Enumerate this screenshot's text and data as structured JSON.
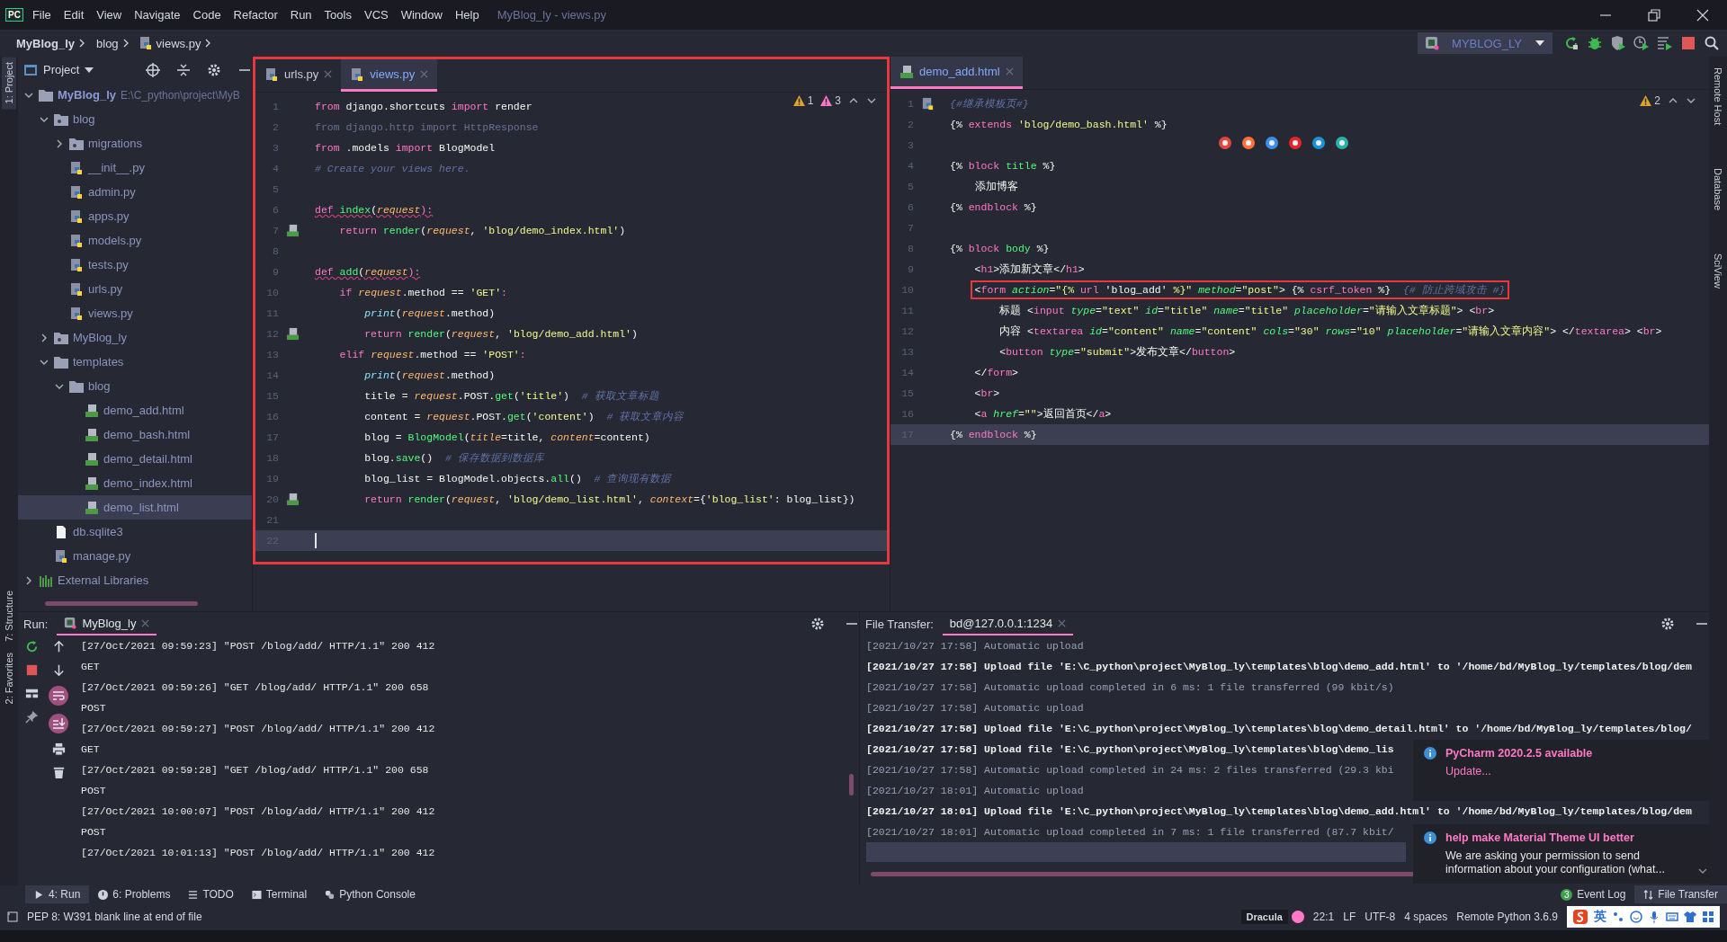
{
  "window": {
    "logo": "PC",
    "menu": [
      "File",
      "Edit",
      "View",
      "Navigate",
      "Code",
      "Refactor",
      "Run",
      "Tools",
      "VCS",
      "Window",
      "Help"
    ],
    "title": "MyBlog_ly - views.py"
  },
  "breadcrumbs": [
    {
      "label": "MyBlog_ly",
      "kind": "project"
    },
    {
      "label": "blog",
      "kind": "folder"
    },
    {
      "label": "views.py",
      "kind": "python"
    }
  ],
  "run_config": {
    "name": "MYBLOG_LY"
  },
  "left_strip": {
    "top": [
      {
        "label": "1: Project",
        "selected": true
      }
    ],
    "bottom": [
      {
        "label": "7: Structure",
        "selected": false
      },
      {
        "label": "2: Favorites",
        "selected": false
      }
    ]
  },
  "right_strip": [
    {
      "label": "Remote Host",
      "selected": false
    },
    {
      "label": "Database",
      "selected": false
    },
    {
      "label": "SciView",
      "selected": false
    }
  ],
  "project_panel": {
    "title": "Project",
    "tree": [
      {
        "name": "MyBlog_ly",
        "path": "E:\\C_python\\project\\MyB",
        "kind": "folder",
        "expanded": true,
        "selected": false,
        "children": [
          {
            "name": "blog",
            "kind": "package",
            "expanded": true,
            "selected": false,
            "children": [
              {
                "name": "migrations",
                "kind": "package",
                "expanded": false,
                "selected": false
              },
              {
                "name": "__init__.py",
                "kind": "python",
                "selected": false
              },
              {
                "name": "admin.py",
                "kind": "python",
                "selected": false
              },
              {
                "name": "apps.py",
                "kind": "python",
                "selected": false
              },
              {
                "name": "models.py",
                "kind": "python",
                "selected": false
              },
              {
                "name": "tests.py",
                "kind": "python",
                "selected": false
              },
              {
                "name": "urls.py",
                "kind": "python",
                "selected": false
              },
              {
                "name": "views.py",
                "kind": "python",
                "selected": false
              }
            ]
          },
          {
            "name": "MyBlog_ly",
            "kind": "package",
            "expanded": false,
            "selected": false
          },
          {
            "name": "templates",
            "kind": "folder",
            "expanded": true,
            "selected": false,
            "children": [
              {
                "name": "blog",
                "kind": "folder",
                "expanded": true,
                "selected": false,
                "children": [
                  {
                    "name": "demo_add.html",
                    "kind": "html",
                    "selected": false
                  },
                  {
                    "name": "demo_bash.html",
                    "kind": "html",
                    "selected": false
                  },
                  {
                    "name": "demo_detail.html",
                    "kind": "html",
                    "selected": false
                  },
                  {
                    "name": "demo_index.html",
                    "kind": "html",
                    "selected": false
                  },
                  {
                    "name": "demo_list.html",
                    "kind": "html",
                    "selected": true
                  }
                ]
              }
            ]
          },
          {
            "name": "db.sqlite3",
            "kind": "file",
            "selected": false
          },
          {
            "name": "manage.py",
            "kind": "python",
            "selected": false
          }
        ]
      },
      {
        "name": "External Libraries",
        "kind": "library",
        "expanded": false,
        "selected": false
      }
    ]
  },
  "editors": [
    {
      "annotated": true,
      "tabs": [
        {
          "label": "urls.py",
          "kind": "python",
          "selected": false
        },
        {
          "label": "views.py",
          "kind": "python",
          "selected": true
        }
      ],
      "inspections": [
        {
          "kind": "warning",
          "count": "1"
        },
        {
          "kind": "weak",
          "count": "3"
        }
      ],
      "lines": [
        {
          "no": "1",
          "tokens": [
            {
              "text": "from",
              "kind": "kw"
            },
            {
              "text": " django.shortcuts ",
              "kind": "txt"
            },
            {
              "text": "import",
              "kind": "kw"
            },
            {
              "text": " render",
              "kind": "txt"
            }
          ]
        },
        {
          "no": "2",
          "tokens": [
            {
              "text": "from django.http import HttpResponse",
              "kind": "dim"
            }
          ]
        },
        {
          "no": "3",
          "tokens": [
            {
              "text": "from",
              "kind": "kw"
            },
            {
              "text": " .models ",
              "kind": "txt"
            },
            {
              "text": "import",
              "kind": "kw"
            },
            {
              "text": " BlogModel",
              "kind": "txt"
            }
          ]
        },
        {
          "no": "4",
          "tokens": [
            {
              "text": "# Create your views here.",
              "kind": "com"
            }
          ]
        },
        {
          "no": "5"
        },
        {
          "no": "6",
          "squiggle": true,
          "tokens": [
            {
              "text": "def ",
              "kind": "kw"
            },
            {
              "text": "index",
              "kind": "fn"
            },
            {
              "text": "(",
              "kind": "txt"
            },
            {
              "text": "request",
              "kind": "par"
            },
            {
              "text": "):",
              "kind": "kw"
            }
          ]
        },
        {
          "no": "7",
          "gutter": {
            "kind": "html"
          },
          "tokens": [
            {
              "text": "    return ",
              "kind": "kw"
            },
            {
              "text": "render",
              "kind": "fn"
            },
            {
              "text": "(",
              "kind": "txt"
            },
            {
              "text": "request",
              "kind": "par"
            },
            {
              "text": ", ",
              "kind": "txt"
            },
            {
              "text": "'blog/demo_index.html'",
              "kind": "str"
            },
            {
              "text": ")",
              "kind": "txt"
            }
          ]
        },
        {
          "no": "8"
        },
        {
          "no": "9",
          "squiggle": true,
          "tokens": [
            {
              "text": "def ",
              "kind": "kw"
            },
            {
              "text": "add",
              "kind": "fn"
            },
            {
              "text": "(",
              "kind": "txt"
            },
            {
              "text": "request",
              "kind": "par"
            },
            {
              "text": "):",
              "kind": "kw"
            }
          ]
        },
        {
          "no": "10",
          "tokens": [
            {
              "text": "    if ",
              "kind": "kw"
            },
            {
              "text": "request",
              "kind": "par"
            },
            {
              "text": ".method == ",
              "kind": "txt"
            },
            {
              "text": "'GET'",
              "kind": "str"
            },
            {
              "text": ":",
              "kind": "kw"
            }
          ]
        },
        {
          "no": "11",
          "tokens": [
            {
              "text": "        print",
              "kind": "bi"
            },
            {
              "text": "(",
              "kind": "txt"
            },
            {
              "text": "request",
              "kind": "par"
            },
            {
              "text": ".method)",
              "kind": "txt"
            }
          ]
        },
        {
          "no": "12",
          "gutter": {
            "kind": "html"
          },
          "tokens": [
            {
              "text": "        return ",
              "kind": "kw"
            },
            {
              "text": "render",
              "kind": "fn"
            },
            {
              "text": "(",
              "kind": "txt"
            },
            {
              "text": "request",
              "kind": "par"
            },
            {
              "text": ", ",
              "kind": "txt"
            },
            {
              "text": "'blog/demo_add.html'",
              "kind": "str"
            },
            {
              "text": ")",
              "kind": "txt"
            }
          ]
        },
        {
          "no": "13",
          "tokens": [
            {
              "text": "    elif ",
              "kind": "kw"
            },
            {
              "text": "request",
              "kind": "par"
            },
            {
              "text": ".method == ",
              "kind": "txt"
            },
            {
              "text": "'POST'",
              "kind": "str"
            },
            {
              "text": ":",
              "kind": "kw"
            }
          ]
        },
        {
          "no": "14",
          "tokens": [
            {
              "text": "        print",
              "kind": "bi"
            },
            {
              "text": "(",
              "kind": "txt"
            },
            {
              "text": "request",
              "kind": "par"
            },
            {
              "text": ".method)",
              "kind": "txt"
            }
          ]
        },
        {
          "no": "15",
          "tokens": [
            {
              "text": "        title = ",
              "kind": "txt"
            },
            {
              "text": "request",
              "kind": "par"
            },
            {
              "text": ".POST.",
              "kind": "txt"
            },
            {
              "text": "get",
              "kind": "fn"
            },
            {
              "text": "(",
              "kind": "txt"
            },
            {
              "text": "'title'",
              "kind": "str"
            },
            {
              "text": ")  ",
              "kind": "txt"
            },
            {
              "text": "# 获取文章标题",
              "kind": "com"
            }
          ]
        },
        {
          "no": "16",
          "tokens": [
            {
              "text": "        content = ",
              "kind": "txt"
            },
            {
              "text": "request",
              "kind": "par"
            },
            {
              "text": ".POST.",
              "kind": "txt"
            },
            {
              "text": "get",
              "kind": "fn"
            },
            {
              "text": "(",
              "kind": "txt"
            },
            {
              "text": "'content'",
              "kind": "str"
            },
            {
              "text": ")  ",
              "kind": "txt"
            },
            {
              "text": "# 获取文章内容",
              "kind": "com"
            }
          ]
        },
        {
          "no": "17",
          "tokens": [
            {
              "text": "        blog = ",
              "kind": "txt"
            },
            {
              "text": "BlogModel",
              "kind": "fn"
            },
            {
              "text": "(",
              "kind": "txt"
            },
            {
              "text": "title",
              "kind": "par"
            },
            {
              "text": "=title, ",
              "kind": "txt"
            },
            {
              "text": "content",
              "kind": "par"
            },
            {
              "text": "=content)",
              "kind": "txt"
            }
          ]
        },
        {
          "no": "18",
          "tokens": [
            {
              "text": "        blog.",
              "kind": "txt"
            },
            {
              "text": "save",
              "kind": "fn"
            },
            {
              "text": "()  ",
              "kind": "txt"
            },
            {
              "text": "# 保存数据到数据库",
              "kind": "com"
            }
          ]
        },
        {
          "no": "19",
          "tokens": [
            {
              "text": "        blog_list = BlogModel.objects.",
              "kind": "txt"
            },
            {
              "text": "all",
              "kind": "fn"
            },
            {
              "text": "()  ",
              "kind": "txt"
            },
            {
              "text": "# 查询现有数据",
              "kind": "com"
            }
          ]
        },
        {
          "no": "20",
          "gutter": {
            "kind": "html"
          },
          "tokens": [
            {
              "text": "        return ",
              "kind": "kw"
            },
            {
              "text": "render",
              "kind": "fn"
            },
            {
              "text": "(",
              "kind": "txt"
            },
            {
              "text": "request",
              "kind": "par"
            },
            {
              "text": ", ",
              "kind": "txt"
            },
            {
              "text": "'blog/demo_list.html'",
              "kind": "str"
            },
            {
              "text": ", ",
              "kind": "txt"
            },
            {
              "text": "context",
              "kind": "par"
            },
            {
              "text": "={",
              "kind": "txt"
            },
            {
              "text": "'blog_list'",
              "kind": "str"
            },
            {
              "text": ": blog_list})",
              "kind": "txt"
            }
          ]
        },
        {
          "no": "21"
        },
        {
          "no": "22",
          "current": true,
          "caret": true
        }
      ]
    },
    {
      "tabs": [
        {
          "label": "demo_add.html",
          "kind": "html",
          "selected": true
        }
      ],
      "inspections": [
        {
          "kind": "warning",
          "count": "2"
        }
      ],
      "lines": [
        {
          "no": "1",
          "gutter": {
            "kind": "python"
          },
          "tokens": [
            {
              "text": "{#继承模板页#}",
              "kind": "com"
            }
          ]
        },
        {
          "no": "2",
          "tokens": [
            {
              "text": "{% ",
              "kind": "txt"
            },
            {
              "text": "extends ",
              "kind": "kw"
            },
            {
              "text": "'blog/demo_bash.html'",
              "kind": "str"
            },
            {
              "text": " %}",
              "kind": "txt"
            }
          ]
        },
        {
          "no": "3"
        },
        {
          "no": "4",
          "tokens": [
            {
              "text": "{% ",
              "kind": "txt"
            },
            {
              "text": "block ",
              "kind": "kw"
            },
            {
              "text": "title",
              "kind": "fn"
            },
            {
              "text": " %}",
              "kind": "txt"
            }
          ]
        },
        {
          "no": "5",
          "tokens": [
            {
              "text": "    添加博客",
              "kind": "txt"
            }
          ]
        },
        {
          "no": "6",
          "tokens": [
            {
              "text": "{% ",
              "kind": "txt"
            },
            {
              "text": "endblock",
              "kind": "kw"
            },
            {
              "text": " %}",
              "kind": "txt"
            }
          ]
        },
        {
          "no": "7"
        },
        {
          "no": "8",
          "tokens": [
            {
              "text": "{% ",
              "kind": "txt"
            },
            {
              "text": "block ",
              "kind": "kw"
            },
            {
              "text": "body",
              "kind": "fn"
            },
            {
              "text": " %}",
              "kind": "txt"
            }
          ]
        },
        {
          "no": "9",
          "tokens": [
            {
              "text": "    <",
              "kind": "txt"
            },
            {
              "text": "h1",
              "kind": "kw"
            },
            {
              "text": ">添加新文章</",
              "kind": "txt"
            },
            {
              "text": "h1",
              "kind": "kw"
            },
            {
              "text": ">",
              "kind": "txt"
            }
          ]
        },
        {
          "no": "10",
          "boxed": true,
          "tokens": [
            {
              "text": "    <",
              "kind": "txt"
            },
            {
              "text": "form ",
              "kind": "kw"
            },
            {
              "text": "action",
              "kind": "attr"
            },
            {
              "text": "=",
              "kind": "txt"
            },
            {
              "text": "\"{% ",
              "kind": "str"
            },
            {
              "text": "url",
              "kind": "kw"
            },
            {
              "text": " 'blog_add' ",
              "kind": "txt"
            },
            {
              "text": "%}\" ",
              "kind": "str"
            },
            {
              "text": "method",
              "kind": "attr"
            },
            {
              "text": "=",
              "kind": "txt"
            },
            {
              "text": "\"post\"",
              "kind": "str"
            },
            {
              "text": "> {% ",
              "kind": "txt"
            },
            {
              "text": "csrf_token",
              "kind": "kw"
            },
            {
              "text": " %}  ",
              "kind": "txt"
            },
            {
              "text": "{# 防止跨域攻击 #}",
              "kind": "com"
            }
          ]
        },
        {
          "no": "11",
          "tokens": [
            {
              "text": "        标题 <",
              "kind": "txt"
            },
            {
              "text": "input ",
              "kind": "kw"
            },
            {
              "text": "type",
              "kind": "attr"
            },
            {
              "text": "=",
              "kind": "txt"
            },
            {
              "text": "\"text\" ",
              "kind": "str"
            },
            {
              "text": "id",
              "kind": "attr"
            },
            {
              "text": "=",
              "kind": "txt"
            },
            {
              "text": "\"title\" ",
              "kind": "str"
            },
            {
              "text": "name",
              "kind": "attr"
            },
            {
              "text": "=",
              "kind": "txt"
            },
            {
              "text": "\"title\" ",
              "kind": "str"
            },
            {
              "text": "placeholder",
              "kind": "attr"
            },
            {
              "text": "=",
              "kind": "txt"
            },
            {
              "text": "\"请输入文章标题\"",
              "kind": "str"
            },
            {
              "text": "> <",
              "kind": "txt"
            },
            {
              "text": "br",
              "kind": "kw"
            },
            {
              "text": ">",
              "kind": "txt"
            }
          ]
        },
        {
          "no": "12",
          "tokens": [
            {
              "text": "        内容 <",
              "kind": "txt"
            },
            {
              "text": "textarea ",
              "kind": "kw"
            },
            {
              "text": "id",
              "kind": "attr"
            },
            {
              "text": "=",
              "kind": "txt"
            },
            {
              "text": "\"content\" ",
              "kind": "str"
            },
            {
              "text": "name",
              "kind": "attr"
            },
            {
              "text": "=",
              "kind": "txt"
            },
            {
              "text": "\"content\" ",
              "kind": "str"
            },
            {
              "text": "cols",
              "kind": "attr"
            },
            {
              "text": "=",
              "kind": "txt"
            },
            {
              "text": "\"30\" ",
              "kind": "str"
            },
            {
              "text": "rows",
              "kind": "attr"
            },
            {
              "text": "=",
              "kind": "txt"
            },
            {
              "text": "\"10\" ",
              "kind": "str"
            },
            {
              "text": "placeholder",
              "kind": "attr"
            },
            {
              "text": "=",
              "kind": "txt"
            },
            {
              "text": "\"请输入文章内容\"",
              "kind": "str"
            },
            {
              "text": "> </",
              "kind": "txt"
            },
            {
              "text": "textarea",
              "kind": "kw"
            },
            {
              "text": "> <",
              "kind": "txt"
            },
            {
              "text": "br",
              "kind": "kw"
            },
            {
              "text": ">",
              "kind": "txt"
            }
          ]
        },
        {
          "no": "13",
          "tokens": [
            {
              "text": "        <",
              "kind": "txt"
            },
            {
              "text": "button ",
              "kind": "kw"
            },
            {
              "text": "type",
              "kind": "attr"
            },
            {
              "text": "=",
              "kind": "txt"
            },
            {
              "text": "\"submit\"",
              "kind": "str"
            },
            {
              "text": ">发布文章</",
              "kind": "txt"
            },
            {
              "text": "button",
              "kind": "kw"
            },
            {
              "text": ">",
              "kind": "txt"
            }
          ]
        },
        {
          "no": "14",
          "tokens": [
            {
              "text": "    </",
              "kind": "txt"
            },
            {
              "text": "form",
              "kind": "kw"
            },
            {
              "text": ">",
              "kind": "txt"
            }
          ]
        },
        {
          "no": "15",
          "tokens": [
            {
              "text": "    <",
              "kind": "txt"
            },
            {
              "text": "br",
              "kind": "kw"
            },
            {
              "text": ">",
              "kind": "txt"
            }
          ]
        },
        {
          "no": "16",
          "tokens": [
            {
              "text": "    <",
              "kind": "txt"
            },
            {
              "text": "a ",
              "kind": "kw"
            },
            {
              "text": "href",
              "kind": "attr"
            },
            {
              "text": "=",
              "kind": "txt"
            },
            {
              "text": "\"\"",
              "kind": "str"
            },
            {
              "text": ">返回首页</",
              "kind": "txt"
            },
            {
              "text": "a",
              "kind": "kw"
            },
            {
              "text": ">",
              "kind": "txt"
            }
          ]
        },
        {
          "no": "17",
          "current": true,
          "tokens": [
            {
              "text": "{% ",
              "kind": "txt"
            },
            {
              "text": "endblock",
              "kind": "kw"
            },
            {
              "text": " %}",
              "kind": "txt"
            }
          ]
        }
      ]
    }
  ],
  "run_panel": {
    "label": "Run:",
    "tab": "MyBlog_ly",
    "lines": [
      "[27/Oct/2021 09:59:23] \"POST /blog/add/ HTTP/1.1\" 200 412",
      "GET",
      "[27/Oct/2021 09:59:26] \"GET /blog/add/ HTTP/1.1\" 200 658",
      "POST",
      "[27/Oct/2021 09:59:27] \"POST /blog/add/ HTTP/1.1\" 200 412",
      "GET",
      "[27/Oct/2021 09:59:28] \"GET /blog/add/ HTTP/1.1\" 200 658",
      "POST",
      "[27/Oct/2021 10:00:07] \"POST /blog/add/ HTTP/1.1\" 200 412",
      "POST",
      "[27/Oct/2021 10:01:13] \"POST /blog/add/ HTTP/1.1\" 200 412"
    ]
  },
  "transfer_panel": {
    "label": "File Transfer:",
    "tab": "bd@127.0.0.1:1234",
    "lines": [
      {
        "kind": "info",
        "text": "[2021/10/27 17:58] Automatic upload"
      },
      {
        "kind": "upload",
        "text": "[2021/10/27 17:58] Upload file 'E:\\C_python\\project\\MyBlog_ly\\templates\\blog\\demo_add.html' to '/home/bd/MyBlog_ly/templates/blog/dem"
      },
      {
        "kind": "info",
        "text": "[2021/10/27 17:58] Automatic upload completed in 6 ms: 1 file transferred (99 kbit/s)"
      },
      {
        "kind": "info",
        "text": "[2021/10/27 17:58] Automatic upload"
      },
      {
        "kind": "upload",
        "text": "[2021/10/27 17:58] Upload file 'E:\\C_python\\project\\MyBlog_ly\\templates\\blog\\demo_detail.html' to '/home/bd/MyBlog_ly/templates/blog/"
      },
      {
        "kind": "upload",
        "text": "[2021/10/27 17:58] Upload file 'E:\\C_python\\project\\MyBlog_ly\\templates\\blog\\demo_lis"
      },
      {
        "kind": "info",
        "text": "[2021/10/27 17:58] Automatic upload completed in 24 ms: 2 files transferred (29.3 kbi"
      },
      {
        "kind": "info",
        "text": "[2021/10/27 18:01] Automatic upload"
      },
      {
        "kind": "upload",
        "text": "[2021/10/27 18:01] Upload file 'E:\\C_python\\project\\MyBlog_ly\\templates\\blog\\demo_add.html' to '/home/bd/MyBlog_ly/templates/blog/dem"
      },
      {
        "kind": "info",
        "text": "[2021/10/27 18:01] Automatic upload completed in 7 ms: 1 file transferred (87.7 kbit/"
      }
    ]
  },
  "notifications": [
    {
      "title": "PyCharm 2020.2.5 available",
      "body": "Update...",
      "kind": "link"
    },
    {
      "title": "help make Material Theme UI better",
      "body": "We are asking your permission to send information about your configuration (what...",
      "kind": "text"
    }
  ],
  "tool_windows": [
    {
      "label": "4: Run",
      "kind": "run",
      "selected": true
    },
    {
      "label": "6: Problems",
      "kind": "problems",
      "selected": false
    },
    {
      "label": "TODO",
      "kind": "todo",
      "selected": false
    },
    {
      "label": "Terminal",
      "kind": "terminal",
      "selected": false
    },
    {
      "label": "Python Console",
      "kind": "python",
      "selected": false
    }
  ],
  "right_tools": [
    {
      "label": "Event Log",
      "badge": "3",
      "selected": false
    },
    {
      "label": "File Transfer",
      "selected": true
    }
  ],
  "status": {
    "message": "PEP 8: W391 blank line at end of file",
    "theme": "Dracula",
    "items": [
      "22:1",
      "LF",
      "UTF-8",
      "4 spaces",
      "Remote Python 3.6.9"
    ]
  },
  "ime": {
    "label": "英"
  }
}
